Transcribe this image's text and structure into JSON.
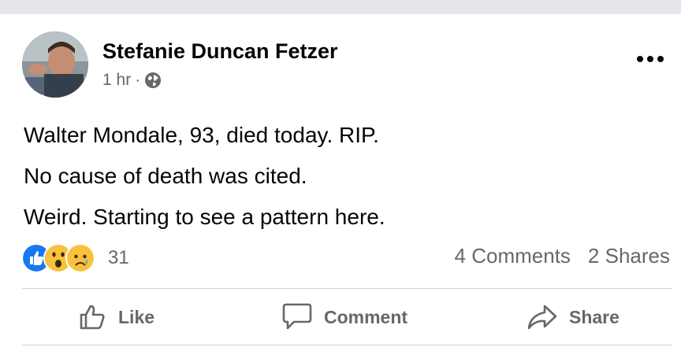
{
  "post": {
    "author": "Stefanie Duncan Fetzer",
    "time": "1 hr",
    "separator": "·",
    "privacy_icon": "globe-icon",
    "lines": [
      "Walter Mondale, 93, died today. RIP.",
      "No cause of death was cited.",
      "Weird. Starting to see a pattern here."
    ]
  },
  "reactions": {
    "icons": [
      "like-reaction-icon",
      "wow-reaction-icon",
      "sad-reaction-icon"
    ],
    "count": "31",
    "comments": "4 Comments",
    "shares": "2 Shares"
  },
  "actions": {
    "like": "Like",
    "comment": "Comment",
    "share": "Share"
  },
  "colors": {
    "like_blue": "#1877f2",
    "secondary_text": "#65676b",
    "divider": "#ced0d4",
    "top_band": "#e4e6eb"
  }
}
